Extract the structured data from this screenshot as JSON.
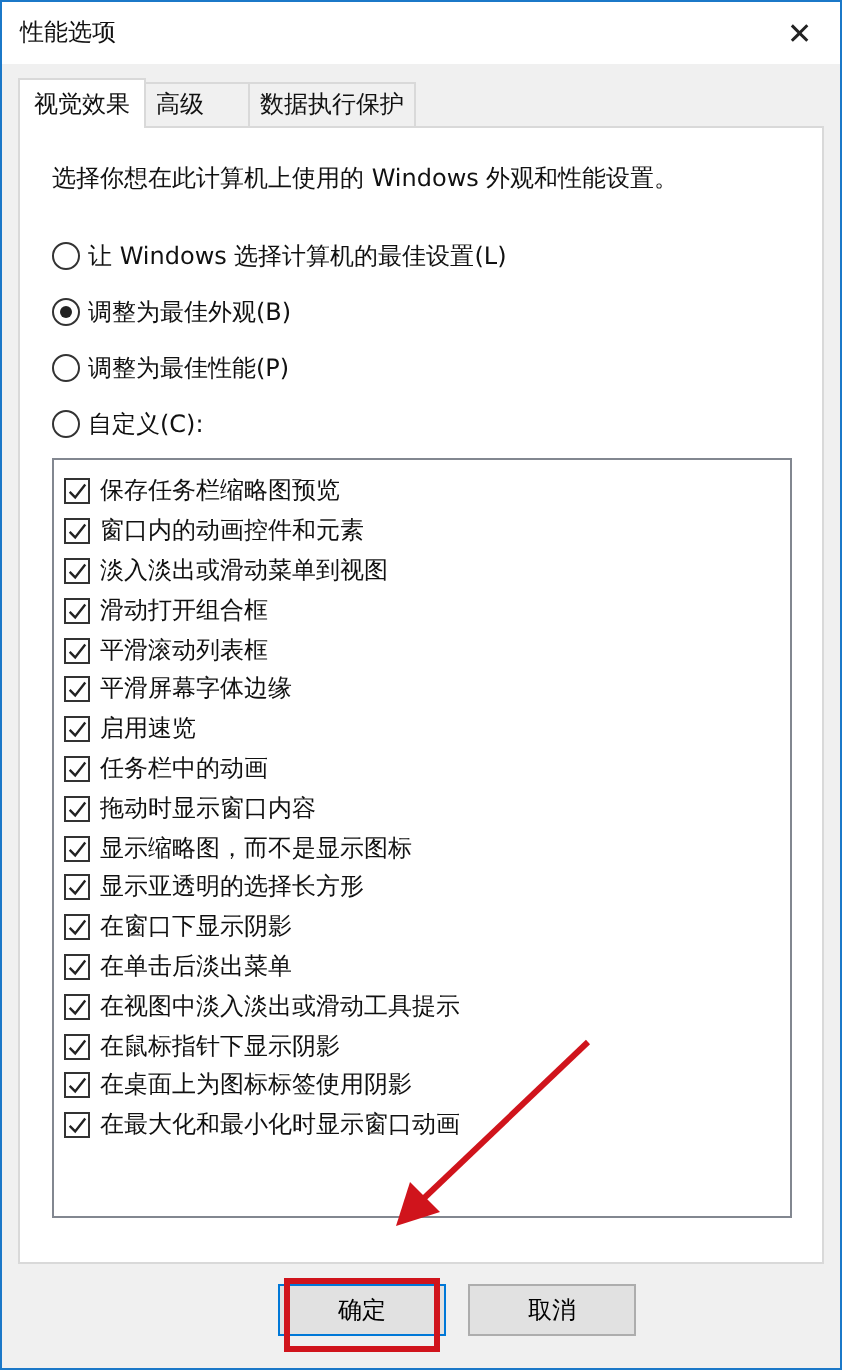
{
  "window": {
    "title": "性能选项",
    "close": "✕"
  },
  "tabs": [
    {
      "label": "视觉效果",
      "selected": true
    },
    {
      "label": "高级",
      "selected": false
    },
    {
      "label": "数据执行保护",
      "selected": false
    }
  ],
  "description": "选择你想在此计算机上使用的 Windows 外观和性能设置。",
  "options": [
    {
      "label": "让 Windows 选择计算机的最佳设置(L)",
      "selected": false
    },
    {
      "label": "调整为最佳外观(B)",
      "selected": true
    },
    {
      "label": "调整为最佳性能(P)",
      "selected": false
    },
    {
      "label": "自定义(C):",
      "selected": false
    }
  ],
  "effects": [
    {
      "label": "保存任务栏缩略图预览",
      "checked": true
    },
    {
      "label": "窗口内的动画控件和元素",
      "checked": true
    },
    {
      "label": "淡入淡出或滑动菜单到视图",
      "checked": true
    },
    {
      "label": "滑动打开组合框",
      "checked": true
    },
    {
      "label": "平滑滚动列表框",
      "checked": true
    },
    {
      "label": "平滑屏幕字体边缘",
      "checked": true
    },
    {
      "label": "启用速览",
      "checked": true
    },
    {
      "label": "任务栏中的动画",
      "checked": true
    },
    {
      "label": "拖动时显示窗口内容",
      "checked": true
    },
    {
      "label": "显示缩略图，而不是显示图标",
      "checked": true
    },
    {
      "label": "显示亚透明的选择长方形",
      "checked": true
    },
    {
      "label": "在窗口下显示阴影",
      "checked": true
    },
    {
      "label": "在单击后淡出菜单",
      "checked": true
    },
    {
      "label": "在视图中淡入淡出或滑动工具提示",
      "checked": true
    },
    {
      "label": "在鼠标指针下显示阴影",
      "checked": true
    },
    {
      "label": "在桌面上为图标标签使用阴影",
      "checked": true
    },
    {
      "label": "在最大化和最小化时显示窗口动画",
      "checked": true
    }
  ],
  "buttons": [
    {
      "label": "确定",
      "highlighted": true
    },
    {
      "label": "取消",
      "highlighted": false
    }
  ],
  "pointer_arrow": true
}
